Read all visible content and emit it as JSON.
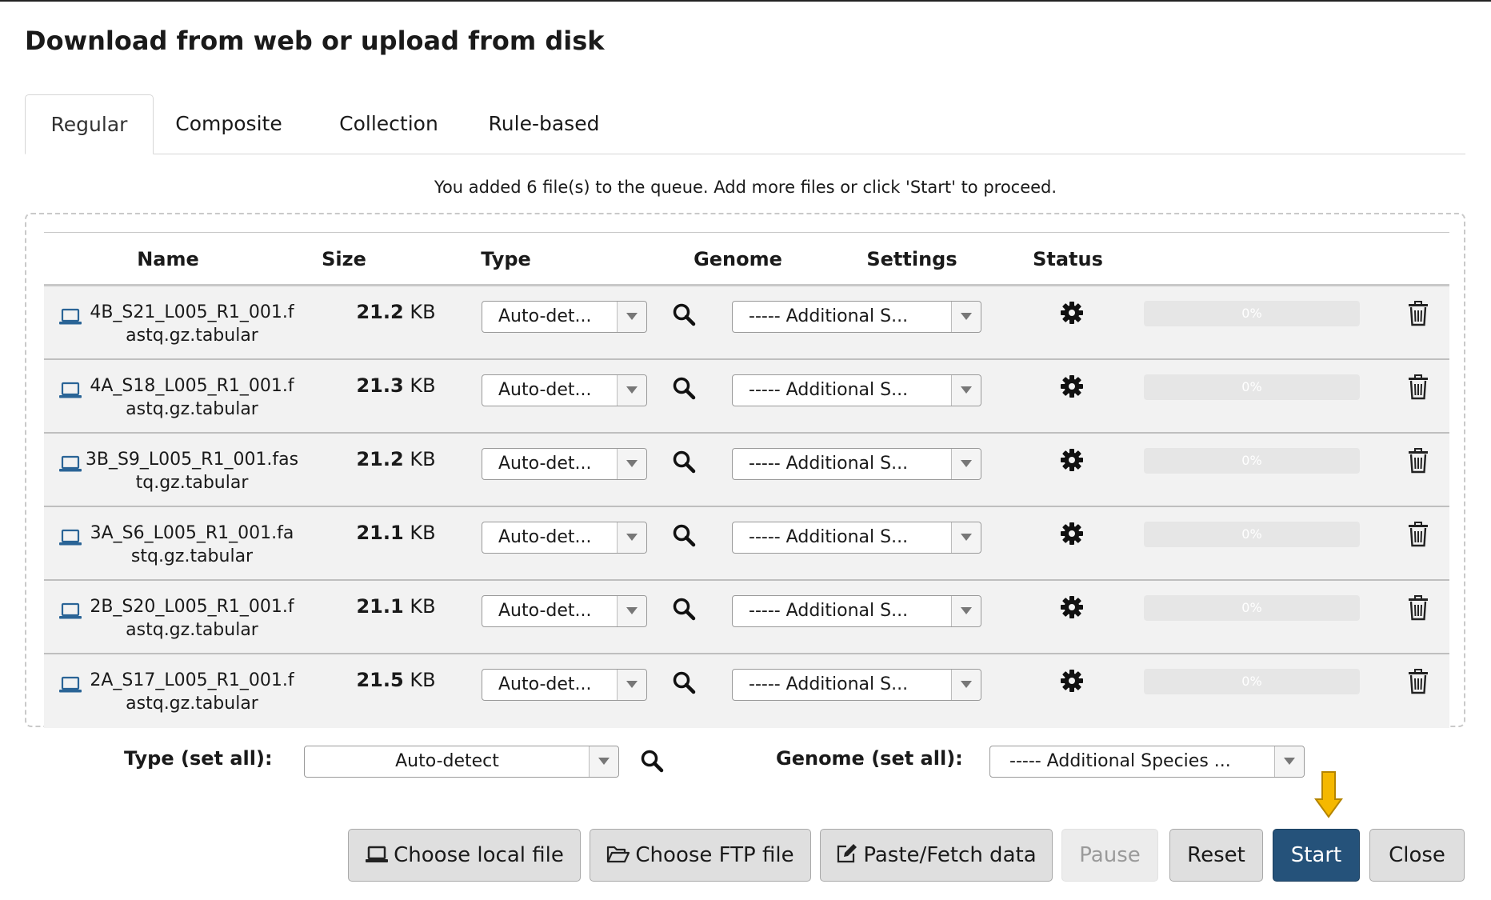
{
  "dialog": {
    "title": "Download from web or upload from disk"
  },
  "tabs": [
    {
      "label": "Regular",
      "active": true
    },
    {
      "label": "Composite",
      "active": false
    },
    {
      "label": "Collection",
      "active": false
    },
    {
      "label": "Rule-based",
      "active": false
    }
  ],
  "queue_message": "You added 6 file(s) to the queue. Add more files or click 'Start' to proceed.",
  "columns": [
    "Name",
    "Size",
    "Type",
    "Genome",
    "Settings",
    "Status"
  ],
  "rows": [
    {
      "name_line1": "4B_S21_L005_R1_001.f",
      "name_line2": "astq.gz.tabular",
      "size_value": "21.2",
      "size_unit": "KB",
      "type": "Auto-det...",
      "genome": "----- Additional S...",
      "status": "0%",
      "progress": 0
    },
    {
      "name_line1": "4A_S18_L005_R1_001.f",
      "name_line2": "astq.gz.tabular",
      "size_value": "21.3",
      "size_unit": "KB",
      "type": "Auto-det...",
      "genome": "----- Additional S...",
      "status": "0%",
      "progress": 0
    },
    {
      "name_line1": "3B_S9_L005_R1_001.fas",
      "name_line2": "tq.gz.tabular",
      "size_value": "21.2",
      "size_unit": "KB",
      "type": "Auto-det...",
      "genome": "----- Additional S...",
      "status": "0%",
      "progress": 0
    },
    {
      "name_line1": "3A_S6_L005_R1_001.fa",
      "name_line2": "stq.gz.tabular",
      "size_value": "21.1",
      "size_unit": "KB",
      "type": "Auto-det...",
      "genome": "----- Additional S...",
      "status": "0%",
      "progress": 0
    },
    {
      "name_line1": "2B_S20_L005_R1_001.f",
      "name_line2": "astq.gz.tabular",
      "size_value": "21.1",
      "size_unit": "KB",
      "type": "Auto-det...",
      "genome": "----- Additional S...",
      "status": "0%",
      "progress": 0
    },
    {
      "name_line1": "2A_S17_L005_R1_001.f",
      "name_line2": "astq.gz.tabular",
      "size_value": "21.5",
      "size_unit": "KB",
      "type": "Auto-det...",
      "genome": "----- Additional S...",
      "status": "0%",
      "progress": 0
    }
  ],
  "set_all": {
    "type_label": "Type (set all):",
    "type_value": "Auto-detect",
    "genome_label": "Genome (set all):",
    "genome_value": "----- Additional Species ..."
  },
  "buttons": {
    "choose_local": "Choose local file",
    "choose_ftp": "Choose FTP file",
    "paste_fetch": "Paste/Fetch data",
    "pause": "Pause",
    "reset": "Reset",
    "start": "Start",
    "close": "Close"
  },
  "icons": {
    "row_name": "laptop-icon",
    "row_search": "search-icon",
    "row_settings": "gear-icon",
    "row_remove": "trash-icon",
    "dropdown": "caret-down-icon",
    "choose_local": "laptop-icon",
    "choose_ftp": "folder-open-icon",
    "paste_fetch": "edit-icon",
    "indicator": "arrow-down-icon"
  },
  "colors": {
    "primary_button": "#25527a",
    "indicator_arrow": "#f5b800",
    "laptop_icon": "#2a6496",
    "row_background": "#f2f2f2"
  }
}
